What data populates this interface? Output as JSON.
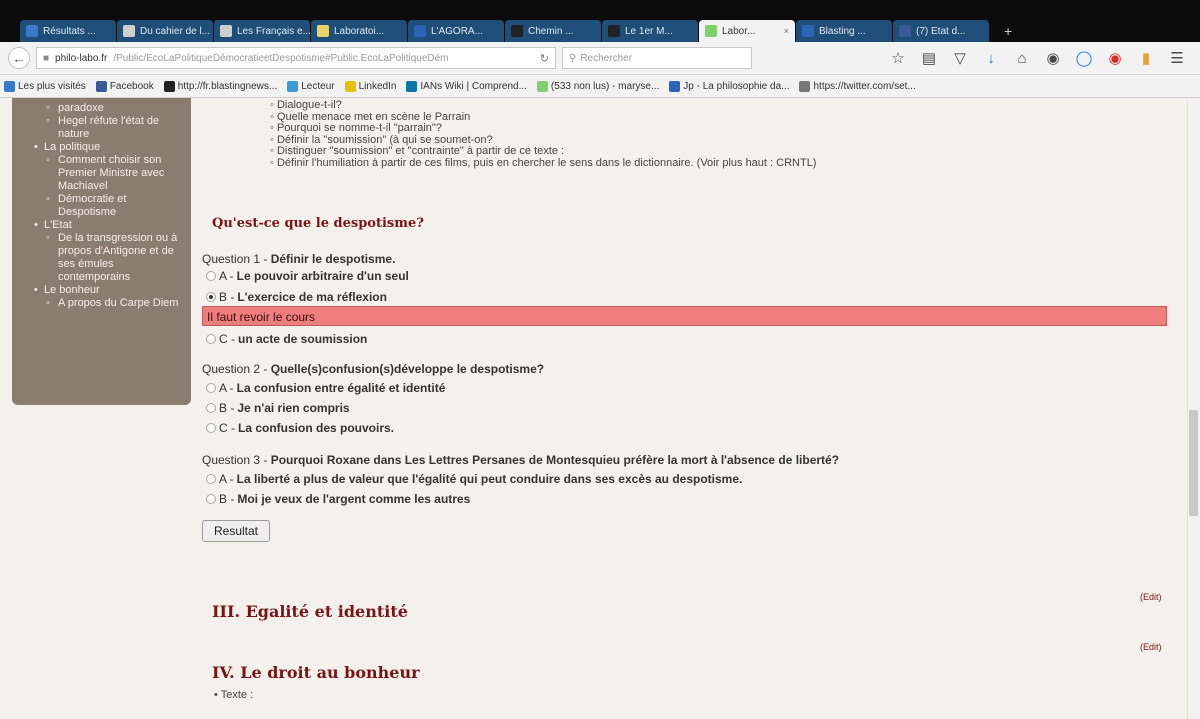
{
  "tabs": [
    {
      "title": "Résultats ...",
      "color": "#3a78c9"
    },
    {
      "title": "Du cahier de l...",
      "color": "#cfcfcf"
    },
    {
      "title": "Les Français e...",
      "color": "#cfcfcf"
    },
    {
      "title": "Laboratoi...",
      "color": "#e8d56a"
    },
    {
      "title": "L'AGORA...",
      "color": "#2b63b8"
    },
    {
      "title": "Chemin ...",
      "color": "#222222"
    },
    {
      "title": "Le 1er M...",
      "color": "#222222"
    },
    {
      "title": "Labor...",
      "color": "#7fcf6a",
      "active": true
    },
    {
      "title": "Blasting ...",
      "color": "#2b63b8"
    },
    {
      "title": "(7) Etat d...",
      "color": "#3b5998"
    }
  ],
  "navbar": {
    "url_host": "philo-labo.fr",
    "url_path": "/Public/EcoLaPolitiqueDémocratieetDespotisme#Public.EcoLaPolitiqueDém",
    "search_placeholder": "Rechercher"
  },
  "bookmarks": [
    "Les plus visités",
    "Facebook",
    "http://fr.blastingnews...",
    "Lecteur",
    "LinkedIn",
    "IANs Wiki | Comprend...",
    "(533 non lus) - maryse...",
    "Jp - La philosophie da...",
    "https://twitter.com/set..."
  ],
  "sidebar": [
    {
      "level": "sub",
      "text": "paradoxe"
    },
    {
      "level": "sub",
      "text": "Hegel réfute l'état de nature"
    },
    {
      "level": "top",
      "text": "La politique"
    },
    {
      "level": "sub",
      "text": "Comment choisir son Premier Ministre avec Machiavel"
    },
    {
      "level": "sub",
      "text": "Démocratie et Despotisme"
    },
    {
      "level": "top",
      "text": "L'Etat"
    },
    {
      "level": "sub",
      "text": "De la transgression ou à propos d'Antigone et de ses émules contemporains"
    },
    {
      "level": "top",
      "text": "Le bonheur"
    },
    {
      "level": "sub",
      "text": "A propos du Carpe Diem"
    }
  ],
  "questions_list": [
    "Dialogue-t-il?",
    "Quelle menace met en scène le Parrain",
    "Pourquoi se nomme-t-il \"parrain\"?",
    "Définir la \"soumission\" (à qui se soumet-on?",
    "Distinguer \"soumission\" et \"contrainte\" à partir de ce texte :",
    "Définir l'humiliation à partir de ces films, puis en chercher le sens dans le dictionnaire. (Voir plus haut : CRNTL)"
  ],
  "quiz": {
    "heading": "Qu'est-ce que le despotisme?",
    "q1": {
      "prefix": "Question 1 - ",
      "text": "Définir le despotisme.",
      "options": [
        {
          "letter": "A - ",
          "text": "Le pouvoir arbitraire d'un seul",
          "selected": false
        },
        {
          "letter": "B - ",
          "text": "L'exercice de ma réflexion",
          "selected": true
        },
        {
          "letter": "C - ",
          "text": "un acte de soumission",
          "selected": false
        }
      ]
    },
    "feedback": "Il faut revoir le cours",
    "q2": {
      "prefix": "Question 2 - ",
      "text": "Quelle(s)confusion(s)développe le despotisme?",
      "options": [
        {
          "letter": "A - ",
          "text": "La confusion entre égalité et identité"
        },
        {
          "letter": "B - ",
          "text": "Je n'ai rien compris"
        },
        {
          "letter": "C - ",
          "text": "La confusion des pouvoirs."
        }
      ]
    },
    "q3": {
      "prefix": "Question 3 - ",
      "text": "Pourquoi Roxane dans Les Lettres Persanes de Montesquieu préfère la mort à l'absence de liberté?",
      "options": [
        {
          "letter": "A - ",
          "text": "La liberté a plus de valeur que l'égalité qui peut conduire dans ses excès au despotisme."
        },
        {
          "letter": "B - ",
          "text": "Moi je veux de l'argent comme les autres"
        }
      ]
    },
    "result_label": "Resultat"
  },
  "edit_label": "(Edit)",
  "section3": "III. Egalité et identité",
  "section4": "IV. Le droit au bonheur",
  "bullet_texte": "Texte :"
}
